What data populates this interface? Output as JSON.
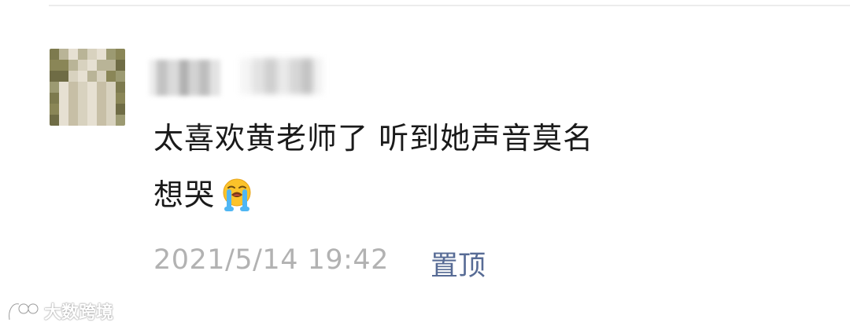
{
  "comment": {
    "line1": "太喜欢黄老师了 听到她声音莫名",
    "line2": "想哭",
    "emoji": "loudly-crying-face-icon",
    "timestamp": "2021/5/14 19:42",
    "pin_label": "置顶"
  },
  "watermark": {
    "text": "大数跨境"
  },
  "colors": {
    "background": "#ffffff",
    "text": "#1a1a1a",
    "timestamp": "#b2b2b2",
    "link": "#576b95"
  }
}
